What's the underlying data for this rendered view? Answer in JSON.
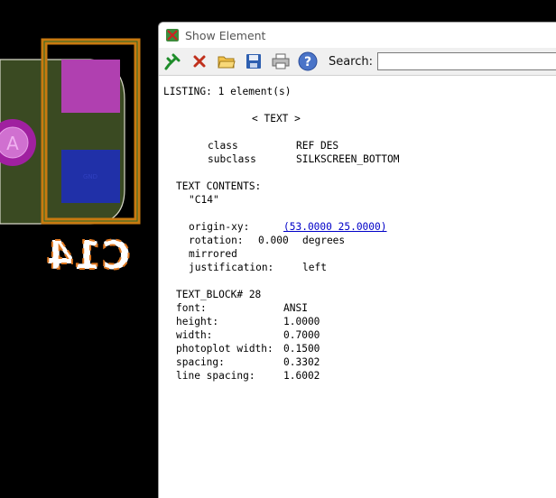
{
  "window": {
    "title": "Show Element",
    "search_label": "Search:",
    "search_value": "",
    "icons": [
      "pin-icon",
      "close-icon",
      "open-folder-icon",
      "save-icon",
      "print-icon",
      "help-icon"
    ]
  },
  "canvas": {
    "pad_labels": [
      "A"
    ],
    "silkscreen_text": "C14"
  },
  "listing": {
    "header": "LISTING: 1 element(s)",
    "element_tag": "< TEXT >",
    "class_label": "class",
    "class_value": "REF DES",
    "subclass_label": "subclass",
    "subclass_value": "SILKSCREEN_BOTTOM",
    "text_contents_label": "TEXT CONTENTS:",
    "text_contents_value": "\"C14\"",
    "origin_label": "origin-xy:",
    "origin_value": "(53.0000 25.0000)",
    "rotation_label": "rotation:",
    "rotation_value": "0.000",
    "rotation_unit": "degrees",
    "mirrored": "mirrored",
    "justification_label": "justification:",
    "justification_value": "left",
    "text_block_label": "TEXT_BLOCK# 28",
    "block": [
      {
        "label": "font:",
        "value": "ANSI"
      },
      {
        "label": "height:",
        "value": "1.0000"
      },
      {
        "label": "width:",
        "value": "0.7000"
      },
      {
        "label": "photoplot width:",
        "value": "0.1500"
      },
      {
        "label": "spacing:",
        "value": "0.3302"
      },
      {
        "label": "line spacing:",
        "value": "1.6002"
      }
    ]
  }
}
